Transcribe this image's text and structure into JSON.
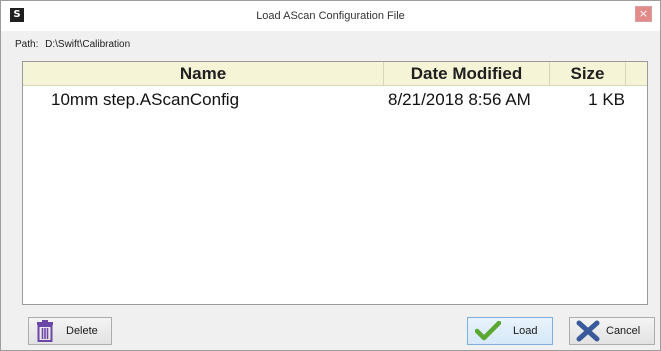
{
  "window": {
    "app_icon_letter": "S",
    "title": "Load AScan Configuration File",
    "close_glyph": "×"
  },
  "path": {
    "label": "Path:",
    "value": "D:\\Swift\\Calibration"
  },
  "file_list": {
    "columns": [
      "Name",
      "Date Modified",
      "Size"
    ],
    "rows": [
      {
        "name": "10mm step.AScanConfig",
        "date_modified": "8/21/2018 8:56 AM",
        "size": "1 KB"
      }
    ]
  },
  "buttons": {
    "delete": {
      "label": "Delete",
      "icon": "trash-icon"
    },
    "load": {
      "label": "Load",
      "icon": "checkmark-icon"
    },
    "cancel": {
      "label": "Cancel",
      "icon": "x-icon"
    }
  },
  "colors": {
    "header_bg": "#f6f4d7",
    "checkmark": "#5aa832",
    "cancel_x": "#3a5a9c",
    "trash": "#6b47a8"
  }
}
